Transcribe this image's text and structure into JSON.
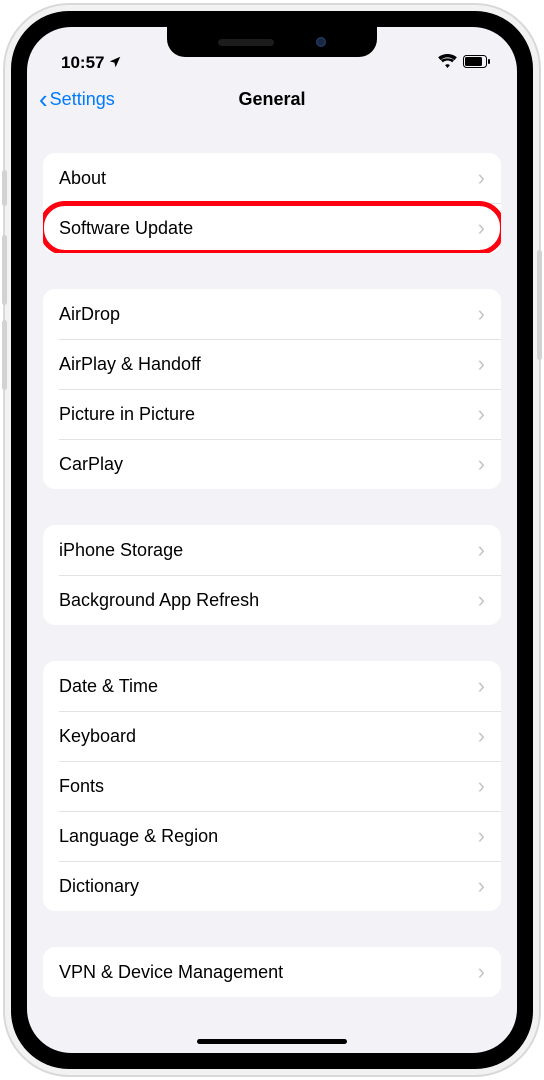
{
  "status": {
    "time": "10:57",
    "locationIcon": "location-arrow"
  },
  "nav": {
    "backLabel": "Settings",
    "title": "General"
  },
  "groups": [
    {
      "rows": [
        {
          "id": "about",
          "label": "About"
        },
        {
          "id": "software-update",
          "label": "Software Update",
          "highlighted": true
        }
      ]
    },
    {
      "rows": [
        {
          "id": "airdrop",
          "label": "AirDrop"
        },
        {
          "id": "airplay-handoff",
          "label": "AirPlay & Handoff"
        },
        {
          "id": "picture-in-picture",
          "label": "Picture in Picture"
        },
        {
          "id": "carplay",
          "label": "CarPlay"
        }
      ]
    },
    {
      "rows": [
        {
          "id": "iphone-storage",
          "label": "iPhone Storage"
        },
        {
          "id": "background-app-refresh",
          "label": "Background App Refresh"
        }
      ]
    },
    {
      "rows": [
        {
          "id": "date-time",
          "label": "Date & Time"
        },
        {
          "id": "keyboard",
          "label": "Keyboard"
        },
        {
          "id": "fonts",
          "label": "Fonts"
        },
        {
          "id": "language-region",
          "label": "Language & Region"
        },
        {
          "id": "dictionary",
          "label": "Dictionary"
        }
      ]
    },
    {
      "rows": [
        {
          "id": "vpn-device-management",
          "label": "VPN & Device Management"
        }
      ]
    }
  ]
}
